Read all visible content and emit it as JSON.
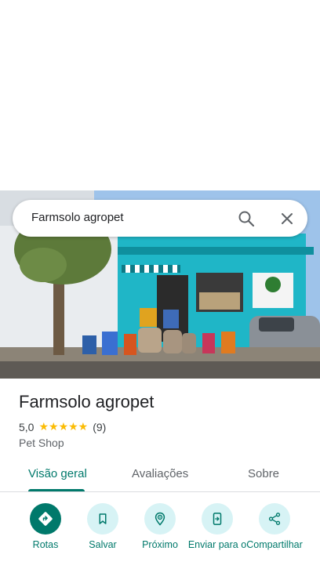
{
  "search": {
    "query": "Farmsolo agropet"
  },
  "place": {
    "name": "Farmsolo agropet",
    "rating": "5,0",
    "stars": "★★★★★",
    "reviews_count": "(9)",
    "category": "Pet Shop"
  },
  "tabs": [
    {
      "label": "Visão geral"
    },
    {
      "label": "Avaliações"
    },
    {
      "label": "Sobre"
    }
  ],
  "actions": [
    {
      "label": "Rotas",
      "icon": "directions-icon"
    },
    {
      "label": "Salvar",
      "icon": "bookmark-icon"
    },
    {
      "label": "Próximo",
      "icon": "nearby-icon"
    },
    {
      "label": "Enviar para o",
      "icon": "send-to-phone-icon"
    },
    {
      "label": "Compartilhar",
      "icon": "share-icon"
    }
  ],
  "colors": {
    "accent": "#00796b",
    "action_bg": "#d7f3f5",
    "star": "#fbbc04"
  }
}
